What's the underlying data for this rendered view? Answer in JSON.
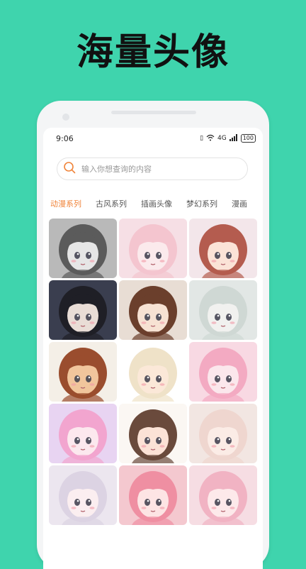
{
  "banner": {
    "title": "海量头像"
  },
  "status": {
    "time": "9:06",
    "network": "4G",
    "battery": "100"
  },
  "search": {
    "placeholder": "输入你想查询的内容"
  },
  "tabs": [
    {
      "label": "动漫系列",
      "active": true
    },
    {
      "label": "古风系列",
      "active": false
    },
    {
      "label": "插画头像",
      "active": false
    },
    {
      "label": "梦幻系列",
      "active": false
    },
    {
      "label": "漫画",
      "active": false
    }
  ],
  "colors": {
    "accent": "#f0843a",
    "background": "#3fd4ad"
  },
  "avatars": [
    {
      "name": "grayscale-anime-girl",
      "bg": "#b9b9b9",
      "hair": "#5b5b5b",
      "skin": "#e6e6e6"
    },
    {
      "name": "pastel-pink-girl",
      "bg": "#f6dfe5",
      "hair": "#f4c5cf",
      "skin": "#fbeaec"
    },
    {
      "name": "brown-hair-headphones",
      "bg": "#f3e6ea",
      "hair": "#b45c4f",
      "skin": "#fbe3d7"
    },
    {
      "name": "dark-hair-boy",
      "bg": "#3a3e4f",
      "hair": "#1f1f26",
      "skin": "#e9ddd6"
    },
    {
      "name": "chocolate-catgirl",
      "bg": "#e8ddd4",
      "hair": "#6b3f2c",
      "skin": "#f7e2d3"
    },
    {
      "name": "sleeping-white-boy",
      "bg": "#e2e7e5",
      "hair": "#cfd8d4",
      "skin": "#f1f1ef"
    },
    {
      "name": "back-home-couple",
      "bg": "#f4efe7",
      "hair": "#9a4d2e",
      "skin": "#f1c59c"
    },
    {
      "name": "chibi-headphones-boy",
      "bg": "#ffffff",
      "hair": "#efe2c8",
      "skin": "#fbe8d8"
    },
    {
      "name": "pink-dreamy-girl",
      "bg": "#f8d9e3",
      "hair": "#f3aac2",
      "skin": "#fbe7ec"
    },
    {
      "name": "rainbow-sparkle-girl",
      "bg": "#e8d4f2",
      "hair": "#f2a5cf",
      "skin": "#fce8ee"
    },
    {
      "name": "chibi-girl-flowers",
      "bg": "#fbf7f3",
      "hair": "#6a4a3c",
      "skin": "#fbe2d6"
    },
    {
      "name": "bunny-ear-girl",
      "bg": "#f2e6e2",
      "hair": "#efd6cf",
      "skin": "#fbece6"
    },
    {
      "name": "silver-hair-girl",
      "bg": "#ece6ef",
      "hair": "#dcd3e3",
      "skin": "#fbeef0"
    },
    {
      "name": "pink-hair-sweets",
      "bg": "#f4c8cf",
      "hair": "#ef8fa2",
      "skin": "#fde4e4"
    },
    {
      "name": "pink-fox-girl",
      "bg": "#f6dde3",
      "hair": "#f1b3c3",
      "skin": "#fde9ea"
    }
  ]
}
